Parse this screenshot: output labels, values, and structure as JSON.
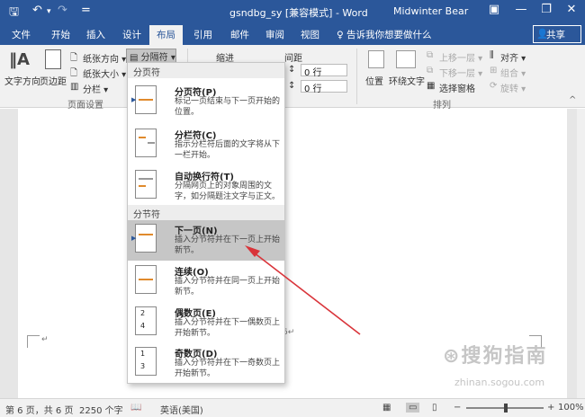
{
  "titlebar": {
    "doc_title": "gsndbg_sy [兼容模式] - Word",
    "user": "Midwinter Bear",
    "save_icon": "save-icon",
    "undo_icon": "undo-icon",
    "redo_icon": "redo-icon",
    "qa_more": "=",
    "min": "—",
    "restore": "❐",
    "close": "✕",
    "ribbon_opts": "▣"
  },
  "tabs": [
    {
      "label": "文件"
    },
    {
      "label": "开始"
    },
    {
      "label": "插入"
    },
    {
      "label": "设计"
    },
    {
      "label": "布局"
    },
    {
      "label": "引用"
    },
    {
      "label": "邮件"
    },
    {
      "label": "审阅"
    },
    {
      "label": "视图"
    }
  ],
  "tell_me": "♀ 告诉我你想要做什么",
  "share": "共享",
  "ribbon": {
    "text_direction": "文字方向",
    "margins": "页边距",
    "orientation": "纸张方向 ▾",
    "size": "纸张大小 ▾",
    "columns": "分栏 ▾",
    "breaks": "分隔符 ▾",
    "indent": "缩进",
    "spacing": "间距",
    "spacing_before": "0 行",
    "spacing_after": "0 行",
    "position": "位置",
    "wrap_text": "环绕文字",
    "bring_forward": "上移一层 ▾",
    "send_backward": "下移一层 ▾",
    "selection_pane": "选择窗格",
    "align": "对齐 ▾",
    "group": "组合 ▾",
    "rotate": "旋转 ▾",
    "group_page_setup": "页面设置",
    "group_arrange": "排列"
  },
  "dropdown": {
    "sec_page": "分页符",
    "sec_section": "分节符",
    "items": [
      {
        "title": "分页符(P)",
        "desc": "标记一页结束与下一页开始的位置。"
      },
      {
        "title": "分栏符(C)",
        "desc": "指示分栏符后面的文字将从下一栏开始。"
      },
      {
        "title": "自动换行符(T)",
        "desc": "分隔网页上的对象周围的文字，如分隔题注文字与正文。"
      },
      {
        "title": "下一页(N)",
        "desc": "插入分节符并在下一页上开始新节。"
      },
      {
        "title": "连续(O)",
        "desc": "插入分节符并在同一页上开始新节。"
      },
      {
        "title": "偶数页(E)",
        "desc": "插入分节符并在下一偶数页上开始新节。"
      },
      {
        "title": "奇数页(D)",
        "desc": "插入分节符并在下一奇数页上开始新节。"
      }
    ]
  },
  "document": {
    "para_mark": "6↵",
    "para_mark2": "↵"
  },
  "status": {
    "pages": "第 6 页，共 6 页",
    "words": "2250 个字",
    "lang": "英语(美国)",
    "zoom": "100%"
  },
  "watermark": "搜狗指南",
  "watermark_url": "zhinan.sogou.com",
  "colors": {
    "accent": "#2b579a",
    "arrow": "#d9343a"
  }
}
